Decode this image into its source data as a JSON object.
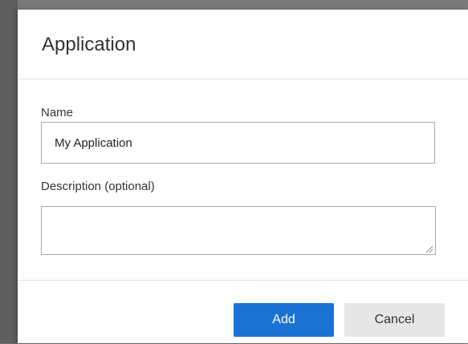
{
  "colors": {
    "primary": "#1a73d2",
    "secondary": "#e6e6e6",
    "overlay": "#6f6f6f"
  },
  "dialog": {
    "title": "Application",
    "fields": {
      "name": {
        "label": "Name",
        "value": "My Application"
      },
      "description": {
        "label": "Description (optional)",
        "value": ""
      }
    },
    "buttons": {
      "add": "Add",
      "cancel": "Cancel"
    }
  }
}
